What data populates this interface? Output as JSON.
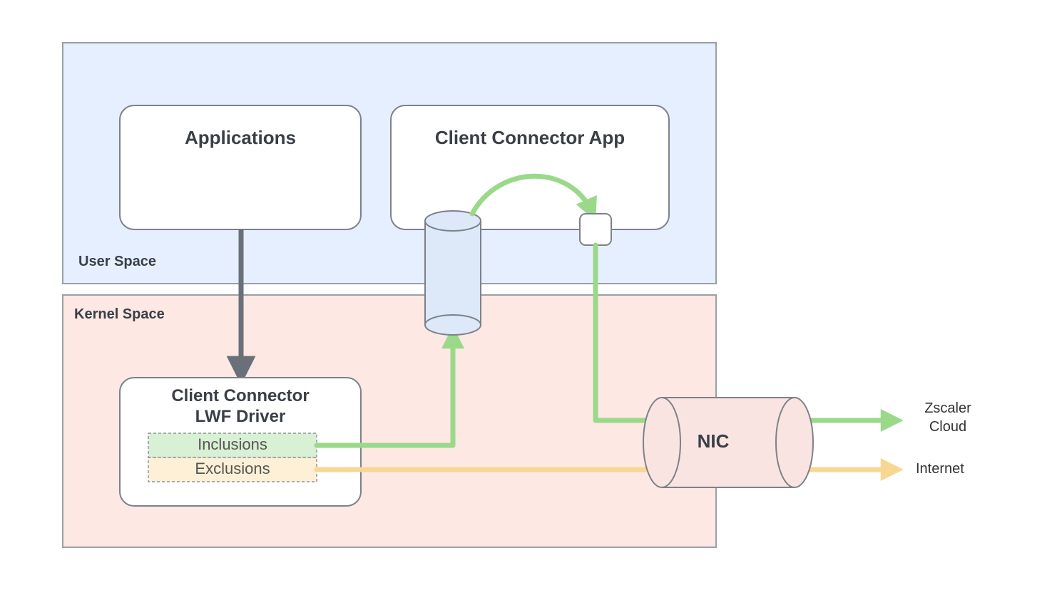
{
  "labels": {
    "user_space": "User Space",
    "kernel_space": "Kernel Space",
    "applications": "Applications",
    "client_connector_app": "Client Connector App",
    "lwf_driver_line1": "Client Connector",
    "lwf_driver_line2": "LWF Driver",
    "inclusions": "Inclusions",
    "exclusions": "Exclusions",
    "nic": "NIC",
    "zscaler_cloud_line1": "Zscaler",
    "zscaler_cloud_line2": "Cloud",
    "internet": "Internet"
  },
  "colors": {
    "user_space_fill": "#e6efff",
    "kernel_space_fill": "#fde8e4",
    "border_gray": "#9aa0a6",
    "box_border": "#7d8189",
    "green_arrow": "#9ad98a",
    "green_arrow_stroke": "#86cf77",
    "yellow_arrow": "#f8d792",
    "inclusions_fill": "#d8f0d3",
    "exclusions_fill": "#fdf0d6",
    "cylinder_fill_blue": "#dde8f8",
    "cylinder_fill_pink": "#fae4e1",
    "dark_arrow": "#6a7079"
  }
}
